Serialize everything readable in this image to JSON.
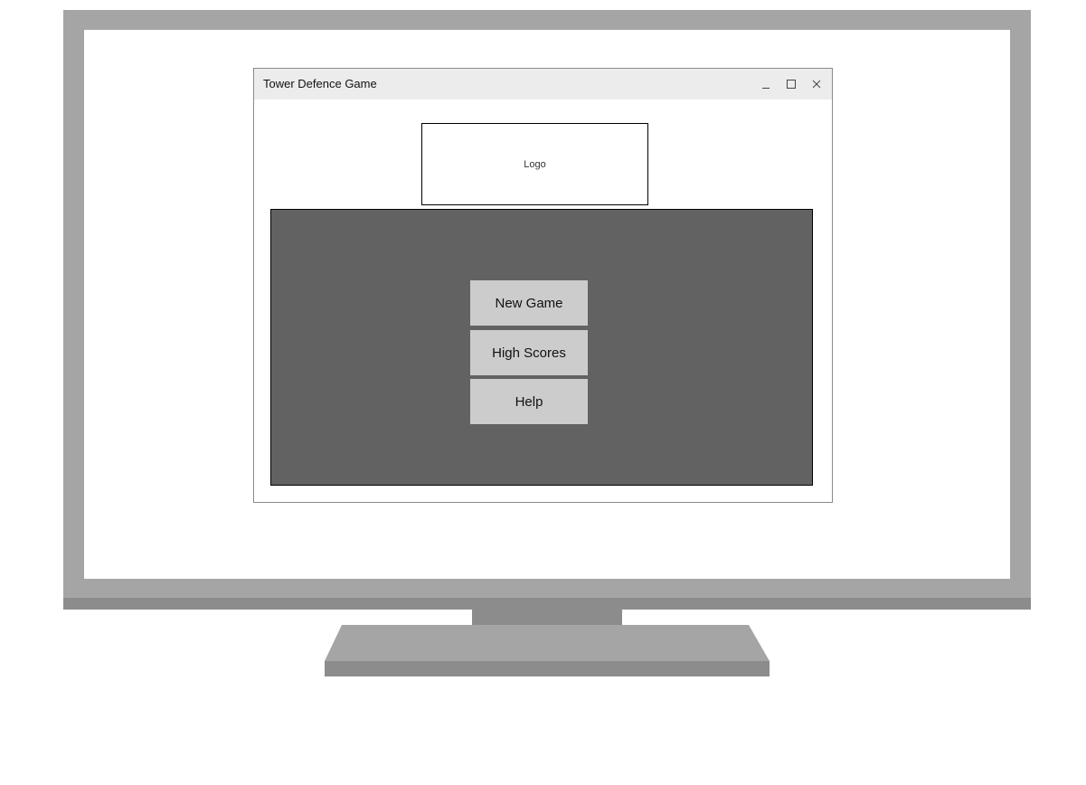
{
  "window": {
    "title": "Tower Defence Game",
    "controls": {
      "minimize_icon": "minimize-icon",
      "maximize_icon": "maximize-icon",
      "close_icon": "close-icon"
    }
  },
  "logo": {
    "label": "Logo"
  },
  "menu": {
    "new_game": "New Game",
    "high_scores": "High Scores",
    "help": "Help"
  },
  "colors": {
    "monitor_frame": "#a5a5a5",
    "monitor_shadow": "#8c8c8c",
    "title_bar": "#ececec",
    "menu_panel": "#626262",
    "menu_button": "#cccccc"
  }
}
